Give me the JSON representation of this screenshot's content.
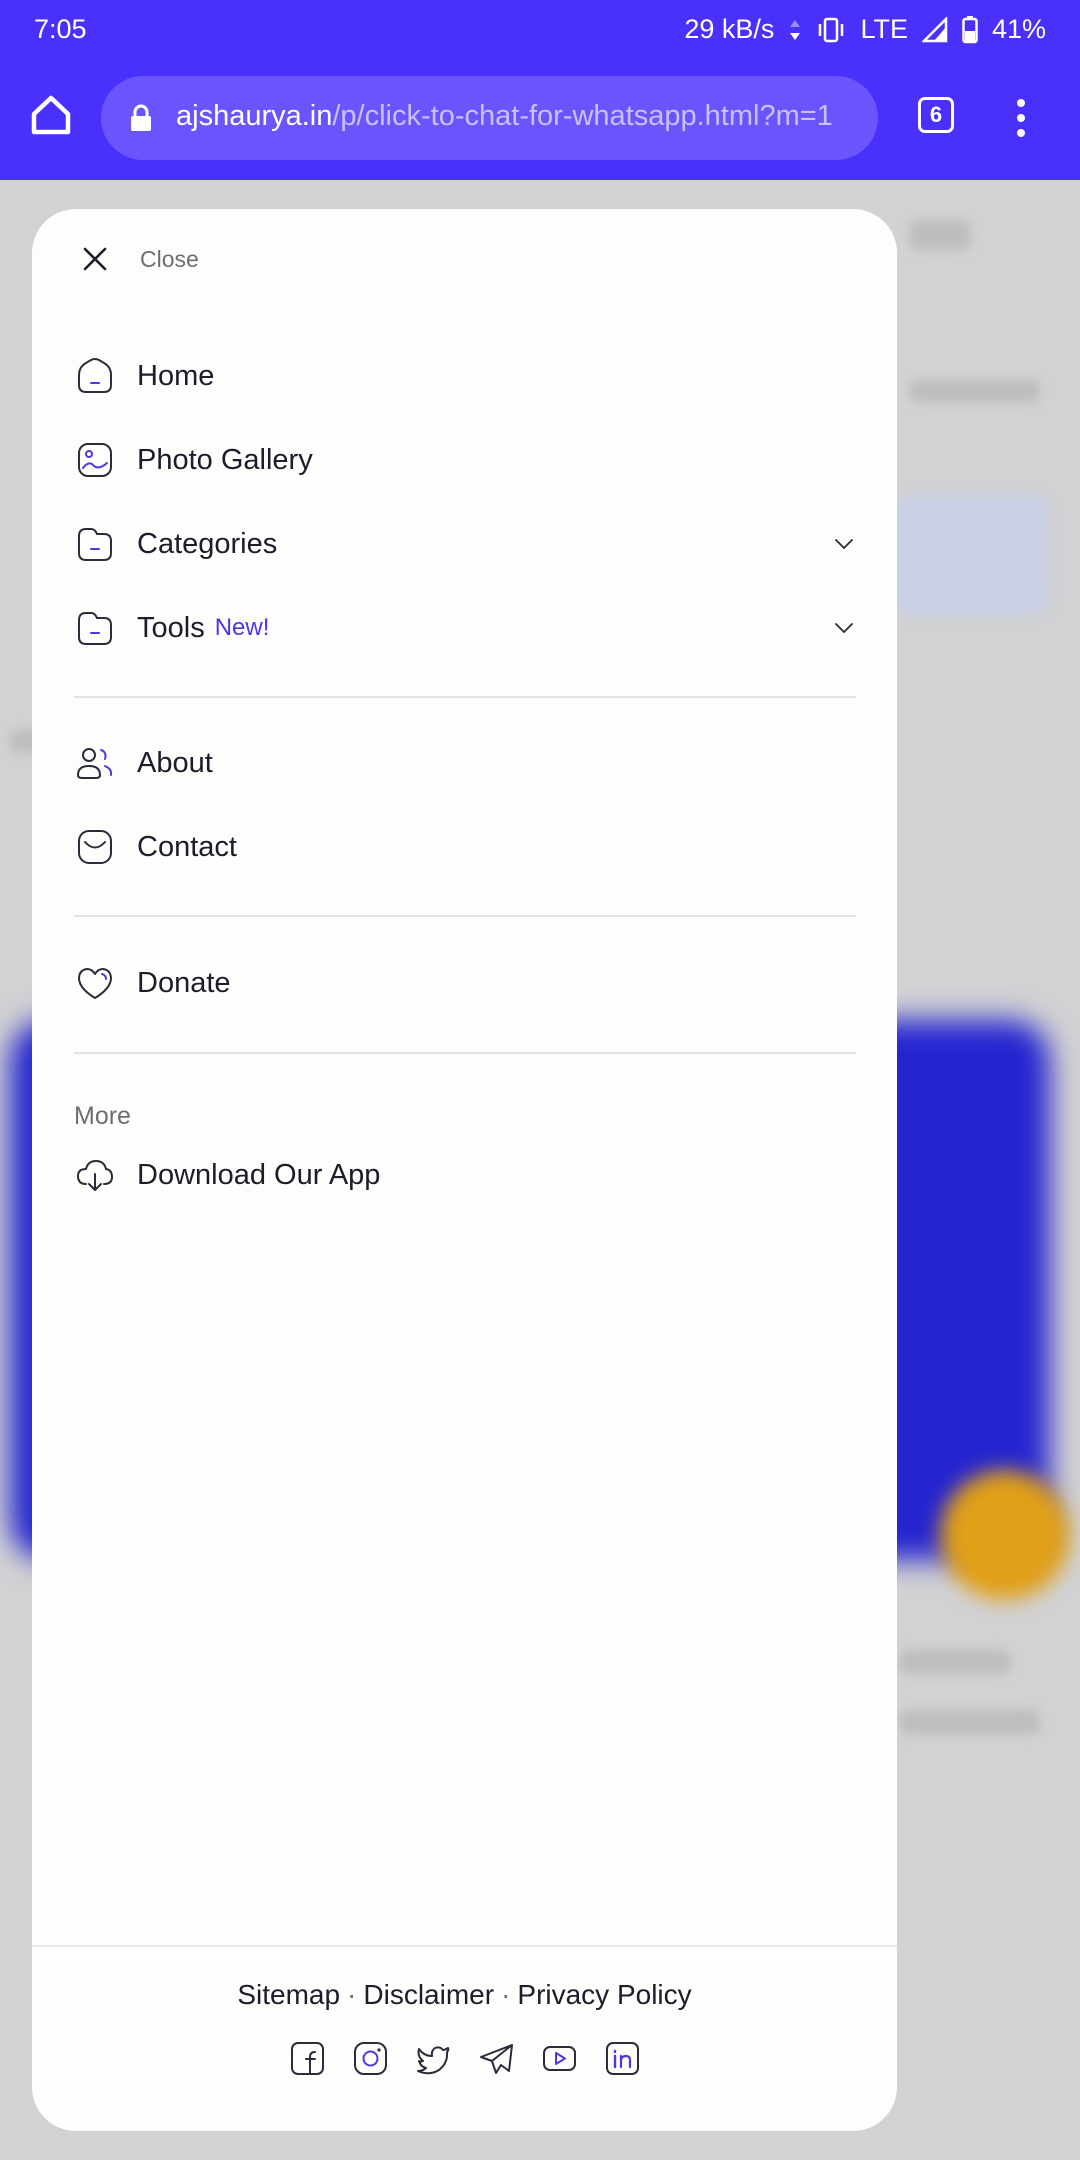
{
  "status_bar": {
    "time": "7:05",
    "network_speed": "29 kB/s",
    "network_type": "LTE",
    "battery": "41%"
  },
  "browser": {
    "url_domain": "ajshaurya.in",
    "url_path": "/p/click-to-chat-for-whatsapp.html?m=1",
    "tab_count": "6"
  },
  "drawer": {
    "close_label": "Close",
    "primary_items": [
      {
        "label": "Home",
        "icon": "home-icon"
      },
      {
        "label": "Photo Gallery",
        "icon": "image-icon"
      },
      {
        "label": "Categories",
        "icon": "folder-icon"
      },
      {
        "label": "Tools",
        "icon": "folder-icon",
        "badge": "New!"
      }
    ],
    "secondary_items": [
      {
        "label": "About",
        "icon": "users-icon"
      },
      {
        "label": "Contact",
        "icon": "mail-icon"
      }
    ],
    "donate": {
      "label": "Donate",
      "icon": "heart-icon"
    },
    "more_section": {
      "heading": "More",
      "items": [
        {
          "label": "Download Our App",
          "icon": "cloud-download-icon"
        }
      ]
    },
    "footer": {
      "links": [
        "Sitemap",
        "Disclaimer",
        "Privacy Policy"
      ],
      "separator": "·",
      "socials": [
        "facebook-icon",
        "instagram-icon",
        "twitter-icon",
        "telegram-icon",
        "youtube-icon",
        "linkedin-icon"
      ]
    }
  },
  "colors": {
    "browser_chrome": "#4930fb",
    "accent": "#4a3ae0",
    "drawer_bg": "#fffdfb"
  }
}
